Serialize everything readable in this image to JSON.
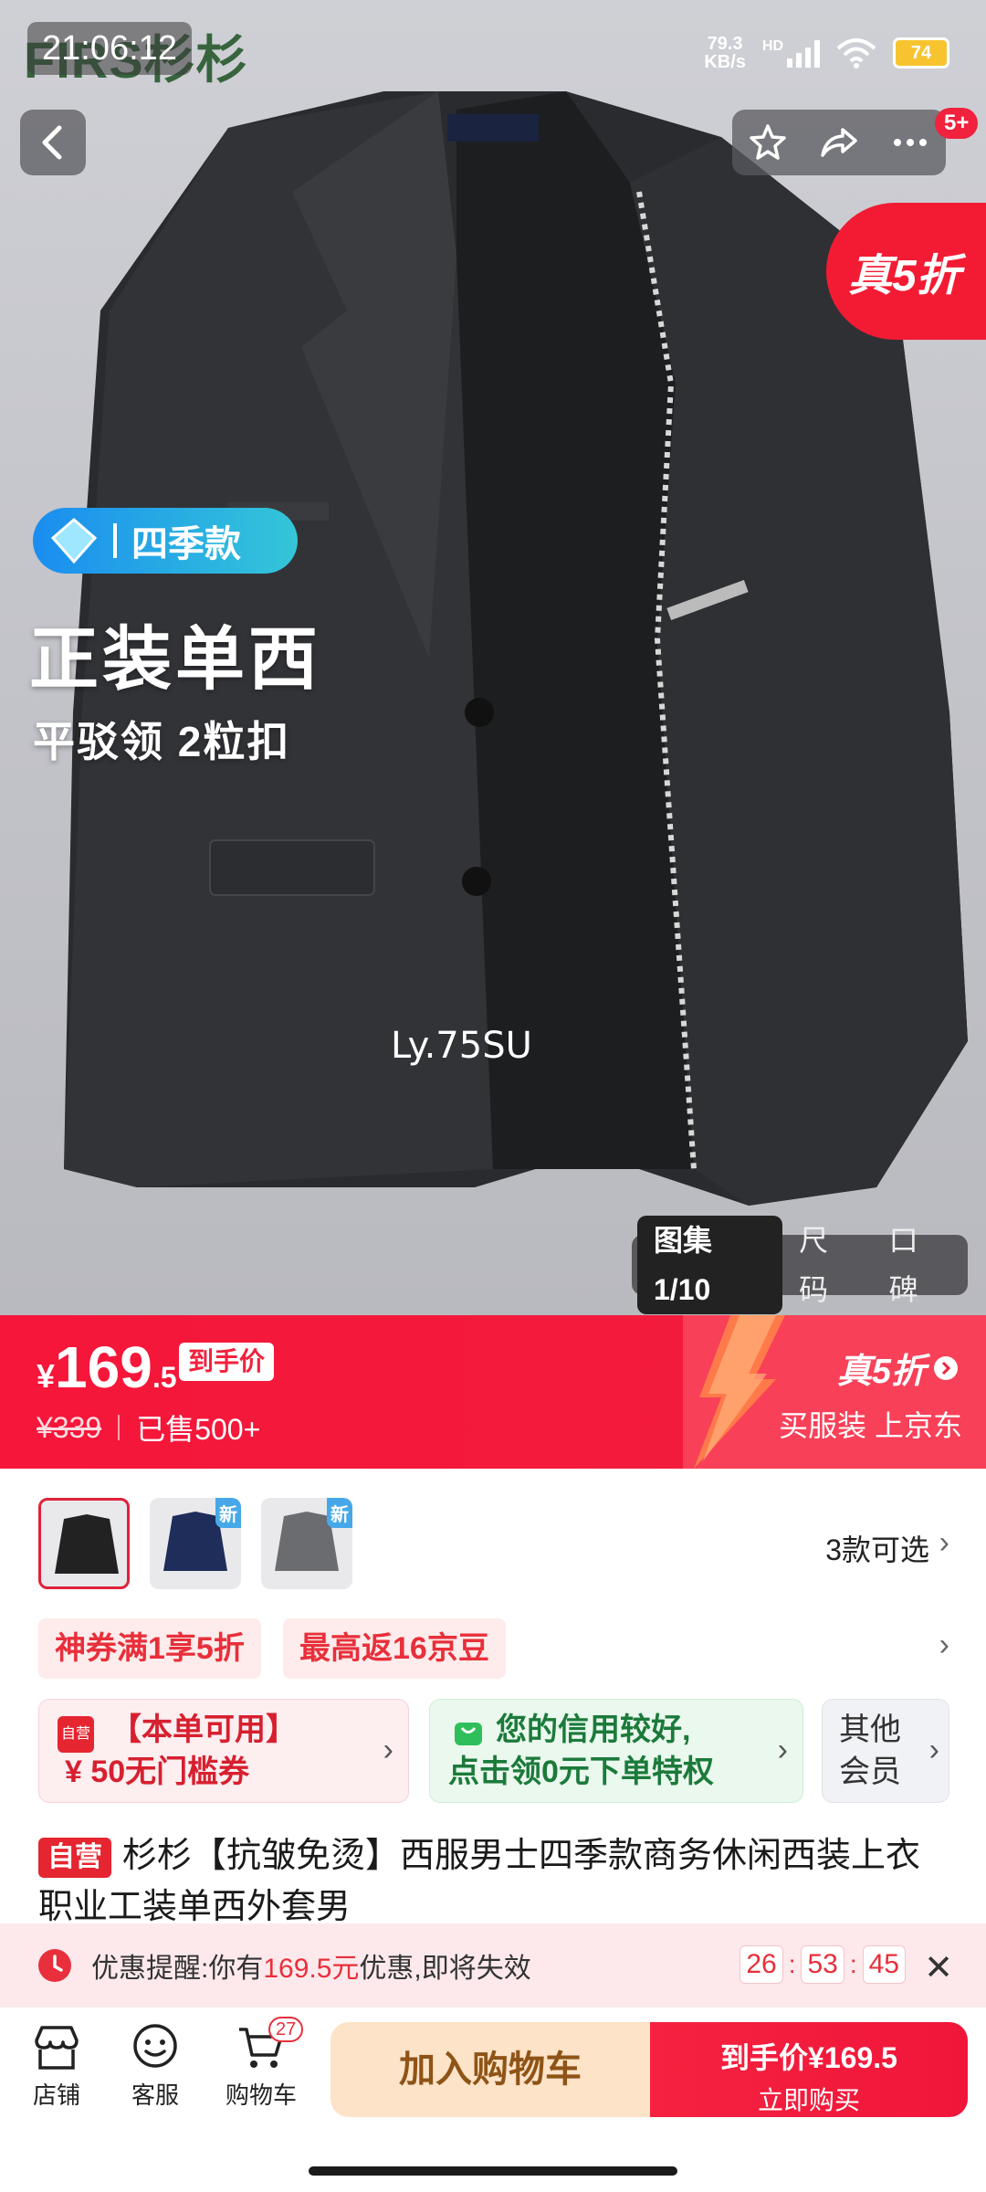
{
  "status_bar": {
    "time": "21:06:12",
    "net_speed": "79.3",
    "net_unit": "KB/s",
    "network": "HD",
    "battery": "74"
  },
  "hero": {
    "brand": "FIRS杉杉",
    "discount": "真5折",
    "season_badge": "四季款",
    "title": "正装单西",
    "subtitle": "平驳领 2粒扣",
    "watermark": "Ly.75SU",
    "message_badge": "5+",
    "gallery_tabs": [
      "图集1/10",
      "尺码",
      "口碑"
    ]
  },
  "price": {
    "symbol": "¥",
    "integer": "169",
    "decimal": ".5",
    "final_label": "到手价",
    "original": "¥339",
    "sold": "已售500+",
    "promo_title": "真5折",
    "promo_sub": "买服装 上京东"
  },
  "variants": {
    "count_label": "3款可选",
    "new_label": "新"
  },
  "coupons": [
    "神券满1享5折",
    "最高返16京豆"
  ],
  "benefits": {
    "coupon_title": "【本单可用】",
    "coupon_value": "¥ 50无门槛券",
    "coupon_tag": "自营",
    "credit_line1": "您的信用较好,",
    "credit_line2": "点击领0元下单特权",
    "member_line1": "其他",
    "member_line2": "会员"
  },
  "product": {
    "self_tag": "自营",
    "title": "杉杉【抗皱免烫】西服男士四季款商务休闲西装上衣职业工装单西外套男"
  },
  "reminder": {
    "prefix": "优惠提醒:你有",
    "amount": "169.5元",
    "suffix": "优惠,即将失效",
    "hh": "26",
    "mm": "53",
    "ss": "45"
  },
  "bottom_bar": {
    "store": "店铺",
    "service": "客服",
    "cart": "购物车",
    "cart_count": "27",
    "add_to_cart": "加入购物车",
    "buy_price": "到手价¥169.5",
    "buy_now": "立即购买"
  },
  "colors": {
    "accent": "#f0223d",
    "cart_button_bg": "#fde3c7",
    "reminder_bg": "#fde9ec"
  }
}
